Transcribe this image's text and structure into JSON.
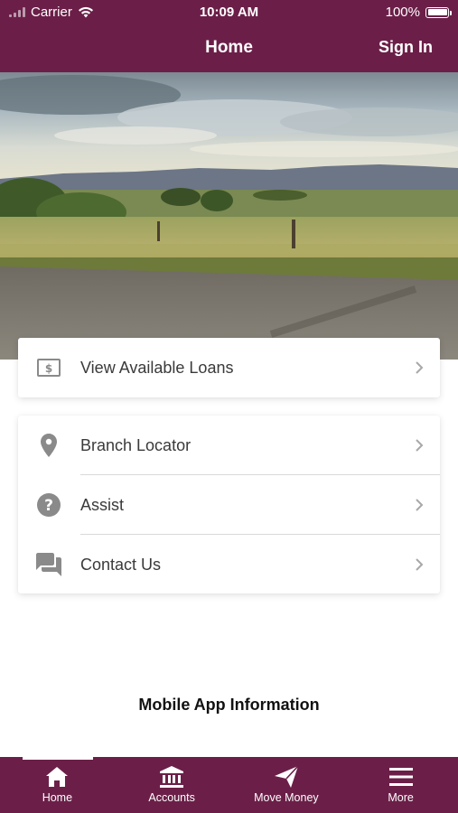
{
  "status_bar": {
    "carrier": "Carrier",
    "time": "10:09 AM",
    "battery": "100%"
  },
  "header": {
    "title": "Home",
    "sign_in_label": "Sign In"
  },
  "colors": {
    "brand": "#6b1f48",
    "icon_gray": "#8a8a8a",
    "chevron_gray": "#a8a8a8"
  },
  "loans_card": {
    "items": [
      {
        "label": "View Available Loans",
        "icon": "dollar-bill-icon"
      }
    ]
  },
  "links_card": {
    "items": [
      {
        "label": "Branch Locator",
        "icon": "location-pin-icon"
      },
      {
        "label": "Assist",
        "icon": "help-circle-icon"
      },
      {
        "label": "Contact Us",
        "icon": "chat-bubbles-icon"
      }
    ]
  },
  "footer": {
    "info_label": "Mobile App Information"
  },
  "tabbar": {
    "tabs": [
      {
        "label": "Home",
        "icon": "home-icon",
        "active": true
      },
      {
        "label": "Accounts",
        "icon": "bank-icon",
        "active": false
      },
      {
        "label": "Move Money",
        "icon": "paper-plane-icon",
        "active": false
      },
      {
        "label": "More",
        "icon": "hamburger-menu-icon",
        "active": false
      }
    ]
  }
}
